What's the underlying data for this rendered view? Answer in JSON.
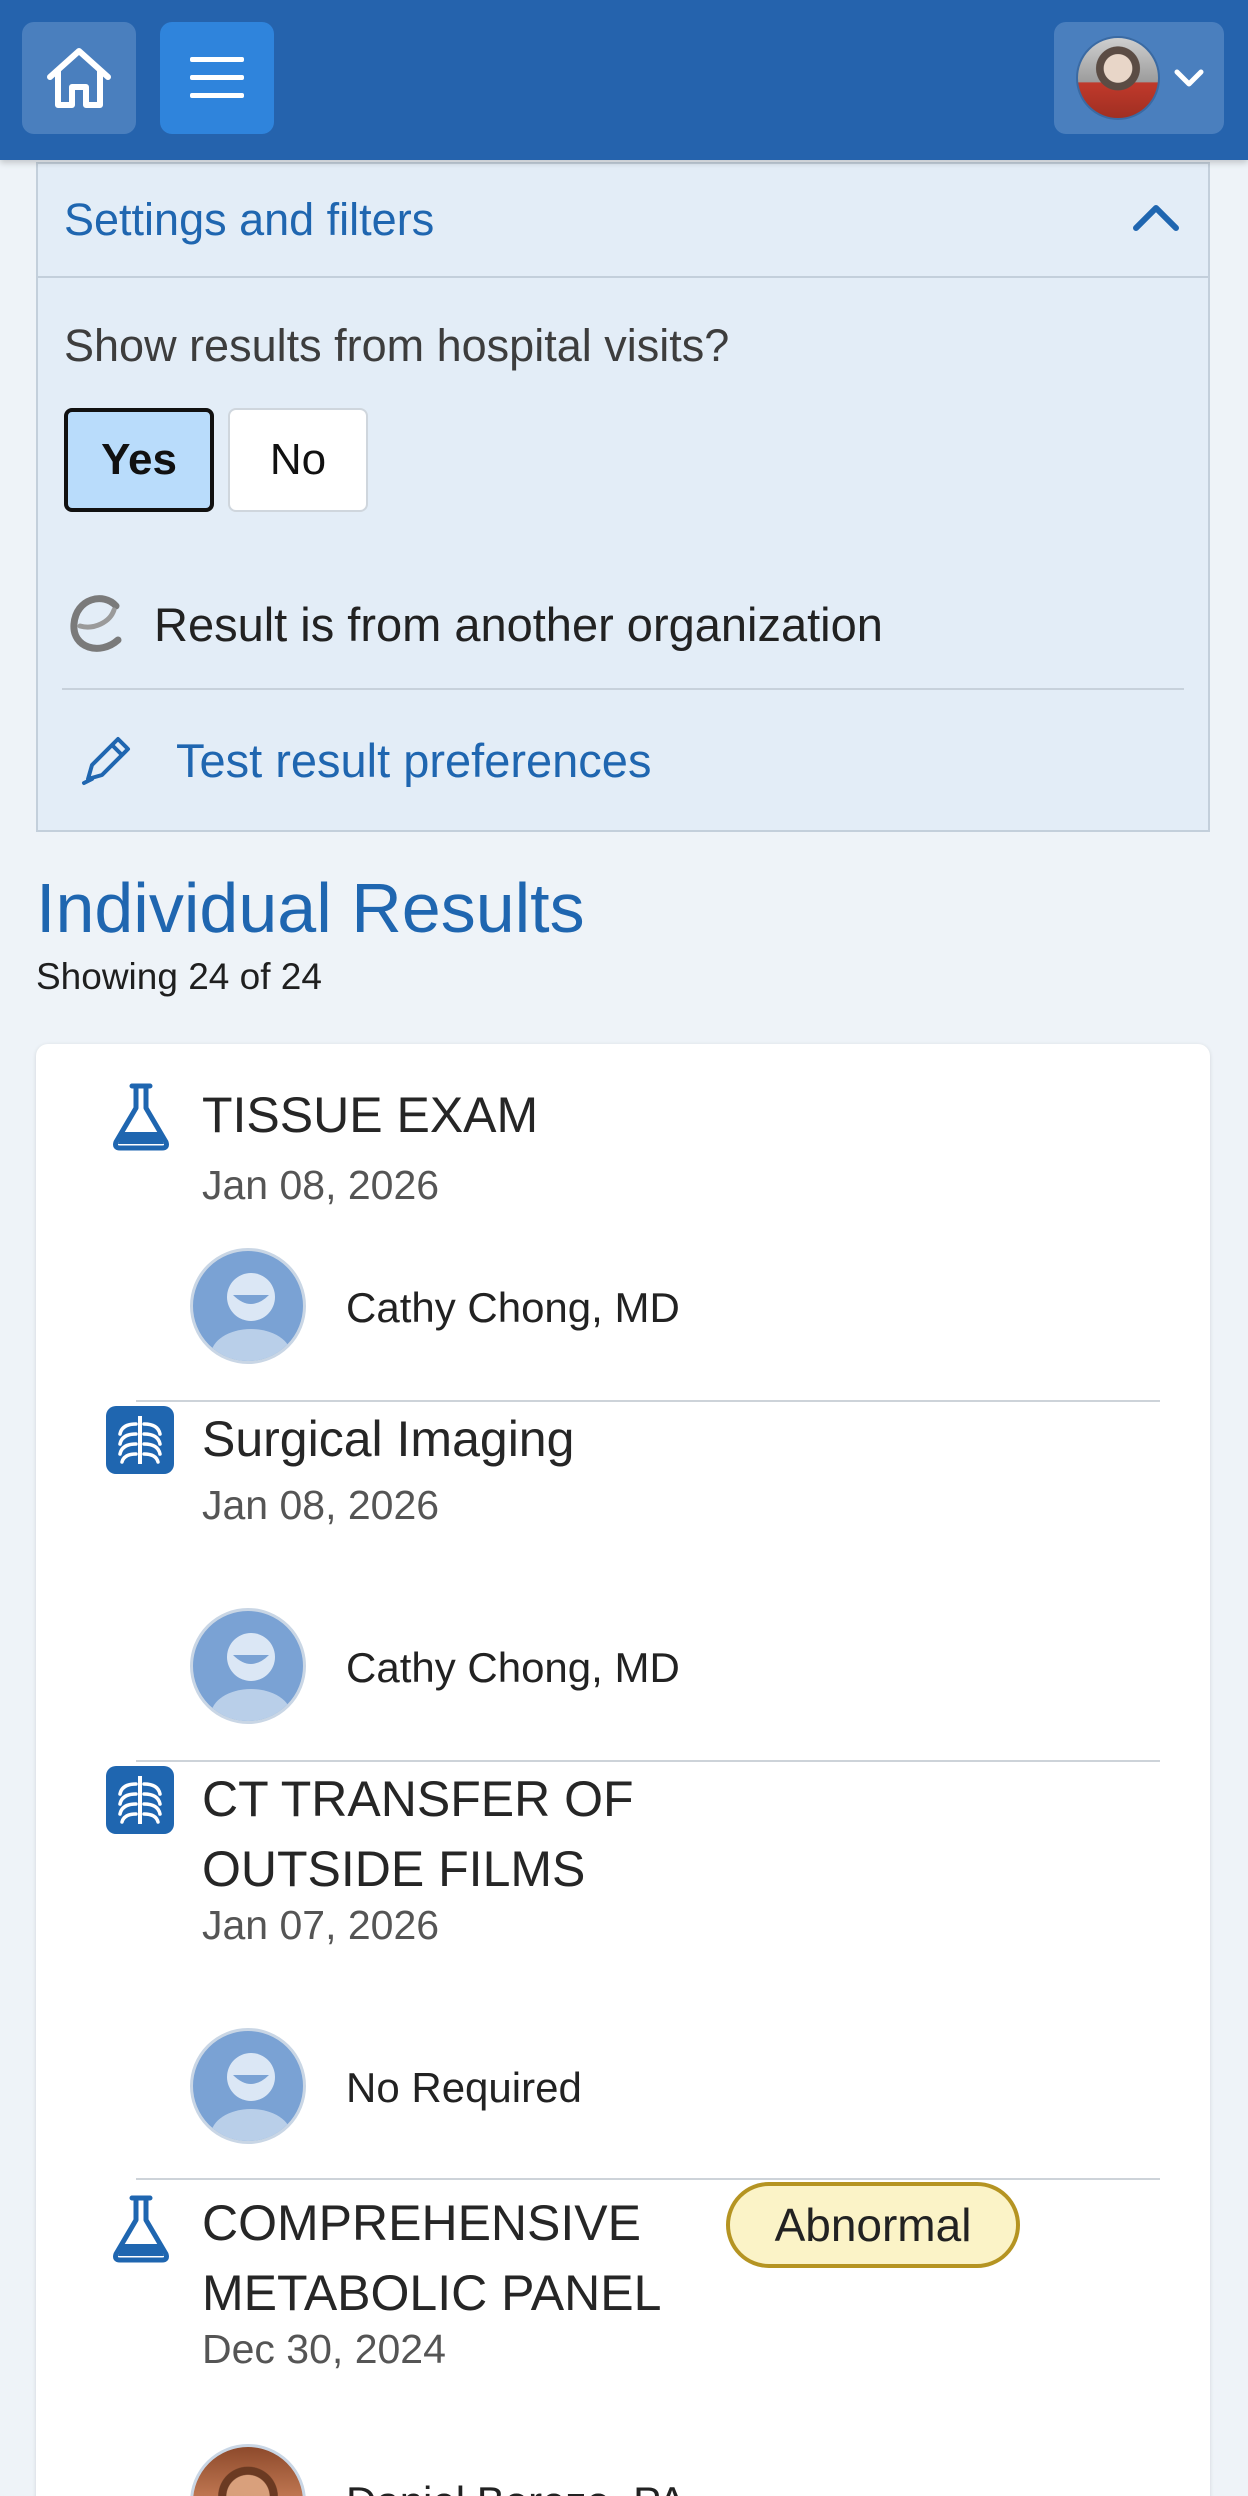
{
  "header": {
    "home_label": "home-icon",
    "menu_label": "menu-icon",
    "account_label": "account-menu"
  },
  "settings": {
    "title": "Settings and filters",
    "question": "Show results from hospital visits?",
    "yes_label": "Yes",
    "no_label": "No",
    "selected": "Yes",
    "org_note": "Result is from another organization",
    "preferences_link": "Test result preferences"
  },
  "results": {
    "title": "Individual Results",
    "count_text": "Showing 24 of 24",
    "items": [
      {
        "icon": "flask-icon",
        "title": "TISSUE EXAM",
        "date": "Jan 08, 2026",
        "provider": "Cathy Chong, MD"
      },
      {
        "icon": "xray-icon",
        "title": "Surgical Imaging",
        "date": "Jan 08, 2026",
        "provider": "Cathy Chong, MD"
      },
      {
        "icon": "xray-icon",
        "title_line1": "CT TRANSFER OF",
        "title_line2": "OUTSIDE FILMS",
        "date": "Jan 07, 2026",
        "provider": "No Required"
      },
      {
        "icon": "flask-icon",
        "title_line1": "COMPREHENSIVE",
        "title_line2": "METABOLIC PANEL",
        "date": "Dec 30, 2024",
        "badge": "Abnormal",
        "provider": "Daniel Borezo, PA"
      }
    ]
  },
  "colors": {
    "topbar": "#2563ad",
    "accent": "#1f66b0",
    "abnormal_badge": "#fbf3c7",
    "abnormal_border": "#b59422"
  }
}
